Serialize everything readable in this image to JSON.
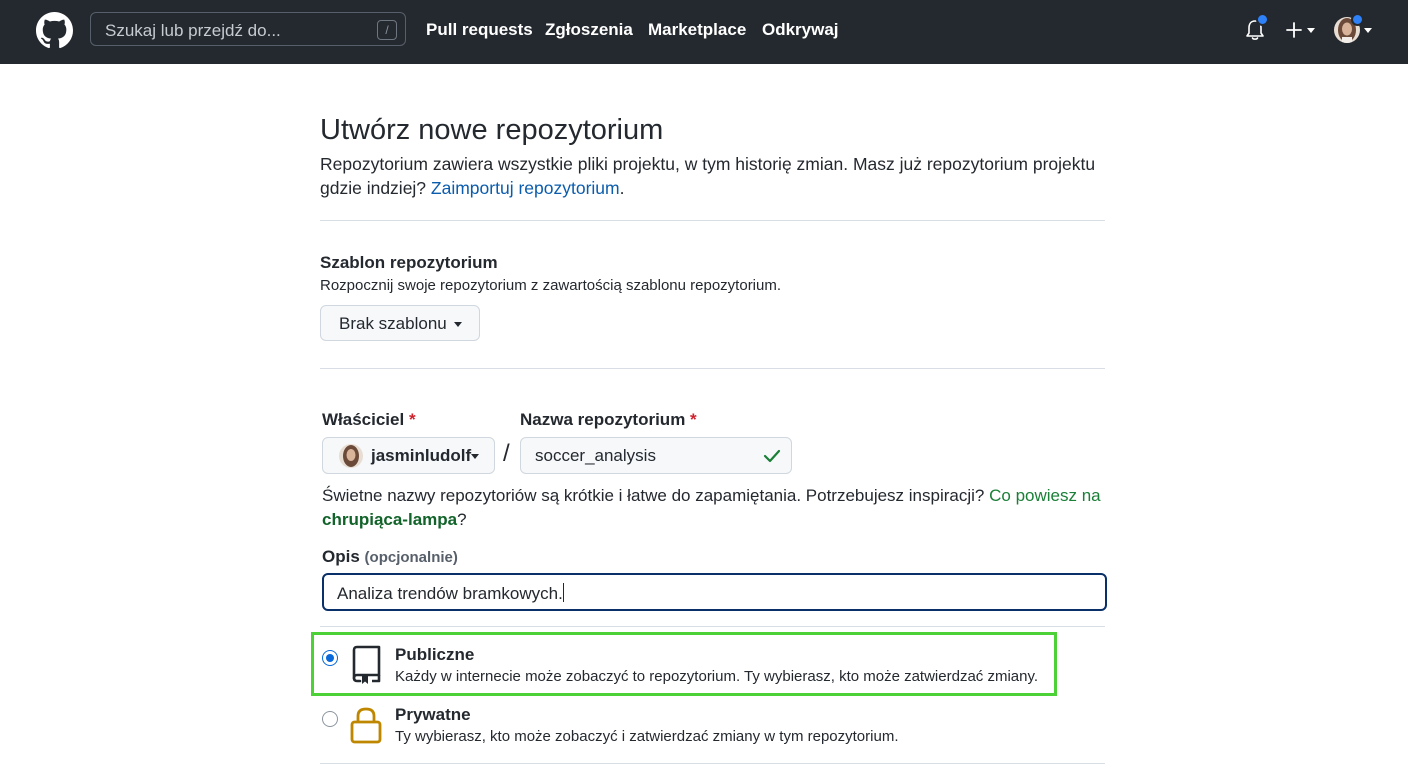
{
  "header": {
    "search_placeholder": "Szukaj lub przejdź do...",
    "search_shortcut": "/",
    "nav": [
      "Pull requests",
      "Zgłoszenia",
      "Marketplace",
      "Odkrywaj"
    ]
  },
  "page": {
    "title": "Utwórz nowe repozytorium",
    "subtitle": "Repozytorium zawiera wszystkie pliki projektu, w tym historię zmian. Masz już repozytorium projektu gdzie indziej?",
    "import_link": "Zaimportuj repozytorium",
    "import_suffix": "."
  },
  "template": {
    "title": "Szablon repozytorium",
    "description": "Rozpocznij swoje repozytorium z zawartością szablonu repozytorium.",
    "selected": "Brak szablonu"
  },
  "owner": {
    "label": "Właściciel",
    "required_mark": "*",
    "value": "jasminludolf"
  },
  "separator": "/",
  "repo_name": {
    "label": "Nazwa repozytorium",
    "required_mark": "*",
    "value": "soccer_analysis"
  },
  "hint": {
    "text": "Świetne nazwy repozytoriów są krótkie i łatwe do zapamiętania. Potrzebujesz inspiracji?",
    "suggestion_prefix": "Co powiesz na",
    "suggestion_name": "chrupiąca-lampa",
    "suggestion_suffix": "?"
  },
  "description": {
    "label": "Opis",
    "optional": "(opcjonalnie)",
    "value": "Analiza trendów bramkowych."
  },
  "visibility": {
    "public": {
      "title": "Publiczne",
      "description": "Każdy w internecie może zobaczyć to repozytorium. Ty wybierasz, kto może zatwierdzać zmiany.",
      "checked": true
    },
    "private": {
      "title": "Prywatne",
      "description": "Ty wybierasz, kto może zobaczyć i zatwierdzać zmiany w tym repozytorium.",
      "checked": false
    }
  },
  "colors": {
    "header_bg": "#24292f",
    "link_blue": "#0b5cad",
    "link_green": "#1a7f37",
    "highlight": "#4cd137",
    "lock_icon": "#bf8700",
    "notification_dot": "#2f81f7"
  },
  "icons": {
    "logo": "github-mark-icon",
    "bell": "bell-icon",
    "plus": "plus-icon",
    "check": "check-icon",
    "repo": "repo-icon",
    "lock": "lock-icon"
  }
}
